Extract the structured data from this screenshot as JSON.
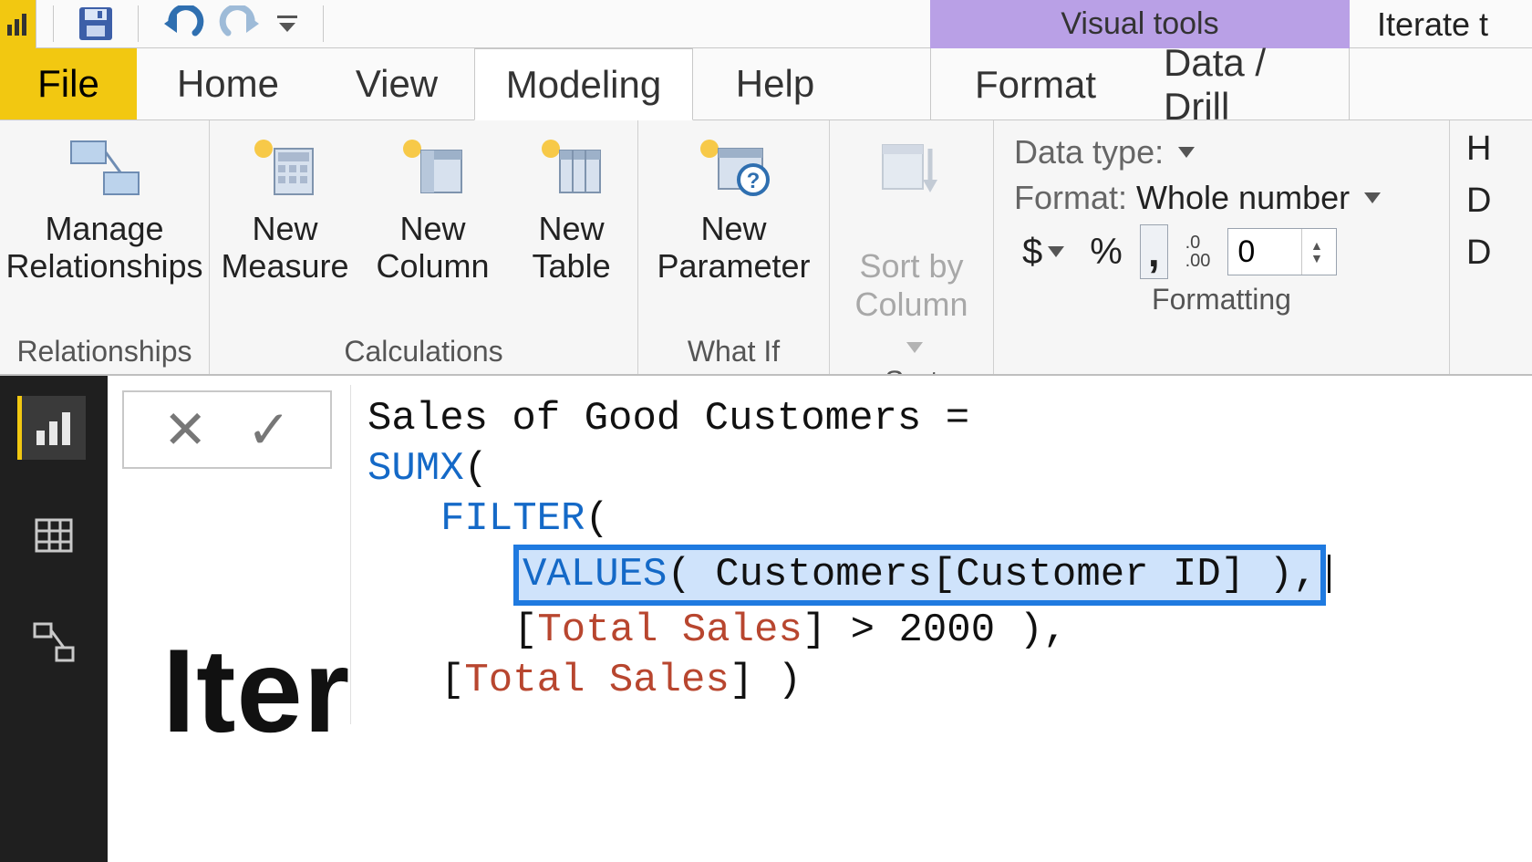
{
  "qat": {
    "save_title": "Save",
    "undo_title": "Undo",
    "redo_title": "Redo",
    "customize_title": "Customize Quick Access Toolbar"
  },
  "title_bar": {
    "contextual_label": "Visual tools",
    "document_title_fragment": "Iterate t"
  },
  "tabs": {
    "file": "File",
    "home": "Home",
    "view": "View",
    "modeling": "Modeling",
    "help": "Help",
    "format": "Format",
    "data_drill": "Data / Drill"
  },
  "ribbon": {
    "relationships": {
      "group_label": "Relationships",
      "manage": "Manage\nRelationships"
    },
    "calculations": {
      "group_label": "Calculations",
      "new_measure": "New\nMeasure",
      "new_column": "New\nColumn",
      "new_table": "New\nTable"
    },
    "whatif": {
      "group_label": "What If",
      "new_parameter": "New\nParameter"
    },
    "sort": {
      "group_label": "Sort",
      "sort_by_column": "Sort by\nColumn"
    },
    "formatting": {
      "group_label": "Formatting",
      "data_type_label": "Data type:",
      "format_label": "Format:",
      "format_value": "Whole number",
      "currency_symbol": "$",
      "percent_symbol": "%",
      "thousands_symbol": ",",
      "decimal_icon_top": ".0",
      "decimal_icon_bottom": ".00",
      "decimal_places_value": "0"
    },
    "trailing": {
      "line1": "H",
      "line2": "D",
      "line3": "D"
    }
  },
  "view_rail": {
    "report_title": "Report",
    "data_title": "Data",
    "model_title": "Model"
  },
  "formula_bar": {
    "cancel_title": "Cancel",
    "commit_title": "Commit"
  },
  "dax": {
    "measure_name": "Sales of Good Customers",
    "eq": " = ",
    "fn_sumx": "SUMX",
    "fn_filter": "FILTER",
    "fn_values": "VALUES",
    "values_arg": " Customers[Customer ID] ",
    "after_values": ",",
    "cond_measure": "Total Sales",
    "cond_rest": " > 2000 ),",
    "ret_measure": "Total Sales",
    "ret_rest": " )"
  },
  "canvas": {
    "background_text": "Iter"
  }
}
